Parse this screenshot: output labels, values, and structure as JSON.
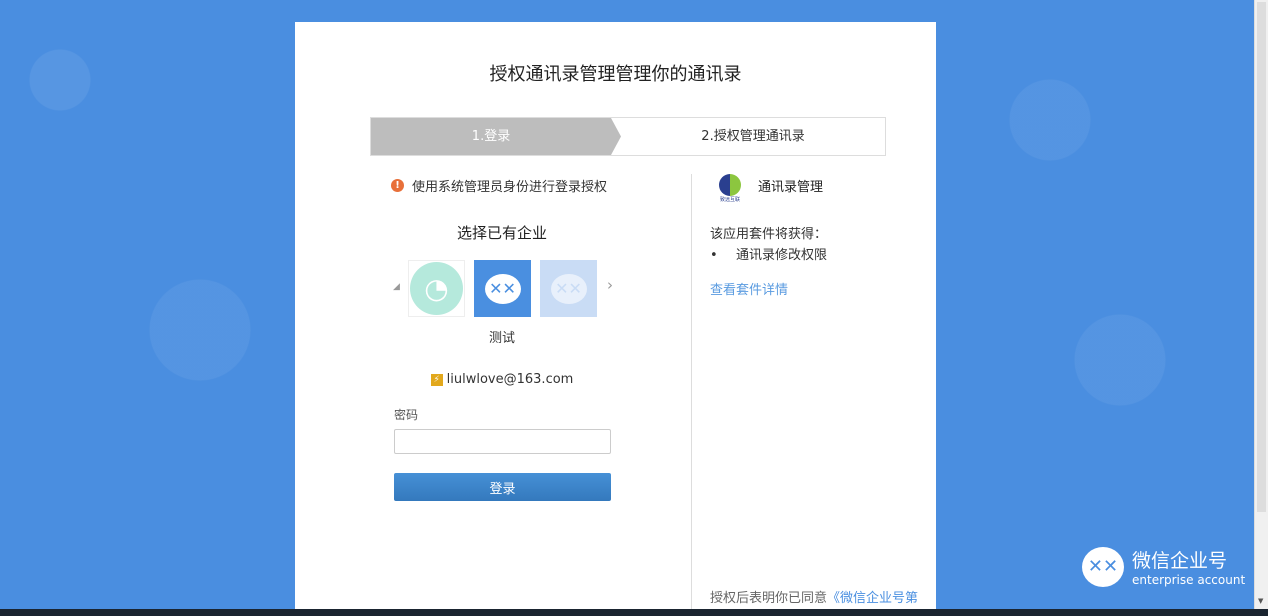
{
  "page": {
    "title": "授权通讯录管理管理你的通讯录"
  },
  "steps": [
    {
      "label": "1.登录"
    },
    {
      "label": "2.授权管理通讯录"
    }
  ],
  "login": {
    "notice": "使用系统管理员身份进行登录授权",
    "select_title": "选择已有企业",
    "selected_corp": "测试",
    "email": "liulwlove@163.com",
    "password_label": "密码",
    "password_value": "",
    "submit_label": "登录"
  },
  "app": {
    "name": "通讯录管理",
    "logo_text": "致远互联",
    "gets_label": "该应用套件将获得：",
    "permissions": [
      "通讯录修改权限"
    ],
    "detail_link": "查看套件详情",
    "agree_text": "授权后表明你已同意",
    "agree_link": "《微信企业号第"
  },
  "brand": {
    "name": "微信企业号",
    "sub": "enterprise account"
  },
  "colors": {
    "background": "#4a8ee0",
    "accent": "#4a8fe0",
    "warning": "#e8703a"
  }
}
